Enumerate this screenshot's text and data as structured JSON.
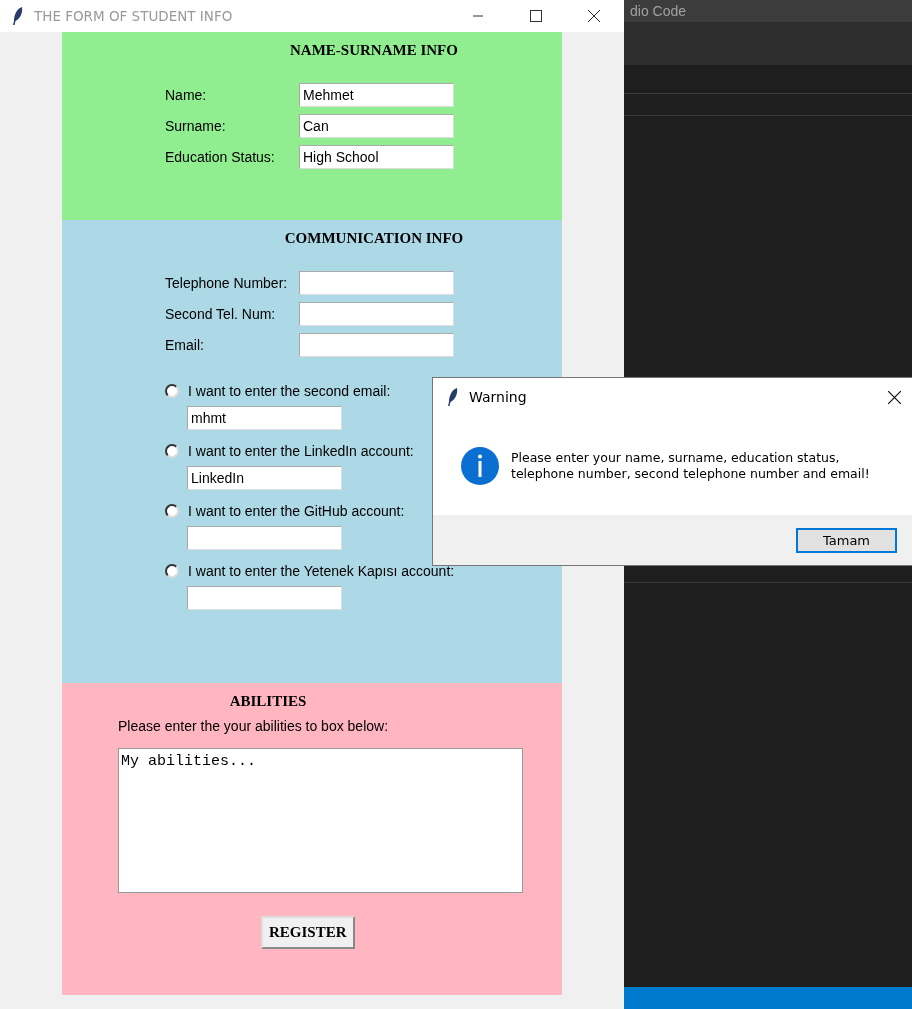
{
  "background_window": {
    "title": "dio Code"
  },
  "window": {
    "title": "THE FORM OF STUDENT INFO"
  },
  "name_section": {
    "heading": "NAME-SURNAME INFO",
    "fields": [
      {
        "label": "Name:",
        "value": "Mehmet"
      },
      {
        "label": "Surname:",
        "value": "Can"
      },
      {
        "label": "Education Status:",
        "value": "High School"
      }
    ]
  },
  "communication_section": {
    "heading": "COMMUNICATION INFO",
    "fields": [
      {
        "label": "Telephone Number:"
      },
      {
        "label": "Second Tel. Num:"
      },
      {
        "label": "Email:"
      }
    ],
    "options": [
      {
        "label": "I want to enter the second email:",
        "selected": false,
        "value": "mhmt"
      },
      {
        "label": "I want to enter the LinkedIn account:",
        "selected": false,
        "value": "LinkedIn"
      },
      {
        "label": "I want to enter the GitHub account:",
        "selected": false
      },
      {
        "label": "I want to enter the Yetenek Kapısı account:",
        "selected": false
      }
    ]
  },
  "abilities_section": {
    "heading": "ABILITIES",
    "instruction": "Please enter the your abilities to box below:",
    "text": "My abilities...",
    "button": "REGISTER"
  },
  "dialog": {
    "title": "Warning",
    "message": "Please enter your name, surname, education status,\ntelephone number, second telephone number and email!",
    "button": "Tamam"
  }
}
